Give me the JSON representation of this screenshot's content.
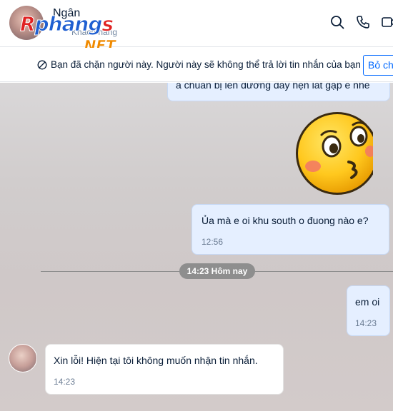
{
  "header": {
    "contact_name": "Ngân",
    "contact_status": "Khách hàng",
    "watermark_main": "Rphangs",
    "watermark_net": ".NET",
    "icons": [
      "search-icon",
      "phone-icon",
      "video-call-icon"
    ]
  },
  "block_notice": {
    "text": "Bạn đã chặn người này. Người này sẽ không thể trả lời tin nhắn của bạn",
    "unblock_label": "Bỏ chặn",
    "icon": "blocked-icon"
  },
  "messages": [
    {
      "direction": "out",
      "text": "a chuẩn bị lên đường đây hẹn lát gặp e nhé",
      "time": ""
    },
    {
      "direction": "out",
      "sticker": "kissing-emoji-sticker"
    },
    {
      "direction": "out",
      "text": "Ủa mà e oi khu south o đuong nào e?",
      "time": "12:56"
    },
    {
      "direction": "out",
      "text": "em oi",
      "time": "14:23"
    },
    {
      "direction": "in",
      "text": "Xin lỗi! Hiện tại tôi không muốn nhận tin nhắn.",
      "time": "14:23"
    }
  ],
  "date_divider": "14:23 Hôm nay",
  "colors": {
    "accent": "#0068ff",
    "outgoing_bubble": "#e5efff",
    "incoming_bubble": "#ffffff"
  }
}
